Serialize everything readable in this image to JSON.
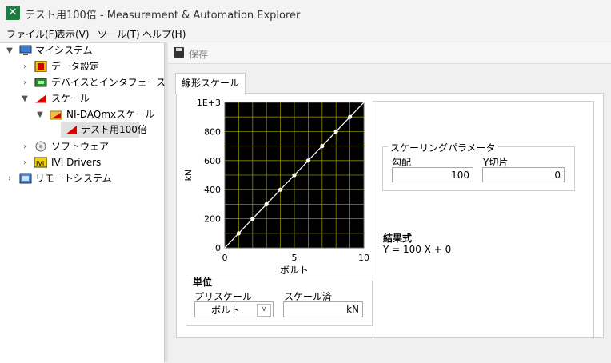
{
  "window": {
    "title": "テスト用100倍 - Measurement & Automation Explorer",
    "icon": "x-logo-icon"
  },
  "menu": [
    {
      "label": "ファイル(F)"
    },
    {
      "label": "表示(V)"
    },
    {
      "label": "ツール(T)"
    },
    {
      "label": "ヘルプ(H)"
    }
  ],
  "tree": {
    "items": [
      {
        "label": "マイシステム",
        "icon": "computer-icon",
        "expanded": true
      },
      {
        "label": "データ設定",
        "icon": "data-config-icon",
        "expanded": false
      },
      {
        "label": "デバイスとインタフェース",
        "icon": "device-icon",
        "expanded": false
      },
      {
        "label": "スケール",
        "icon": "scale-icon",
        "expanded": true
      },
      {
        "label": "NI-DAQmxスケール",
        "icon": "folder-icon",
        "expanded": true
      },
      {
        "label": "テスト用100倍",
        "icon": "scale-icon",
        "selected": true
      },
      {
        "label": "ソフトウェア",
        "icon": "software-icon",
        "expanded": false
      },
      {
        "label": "IVI Drivers",
        "icon": "ivi-icon",
        "expanded": false
      },
      {
        "label": "リモートシステム",
        "icon": "network-icon",
        "expanded": false
      }
    ]
  },
  "toolbar": {
    "save_label": "保存"
  },
  "tab": {
    "label": "線形スケール"
  },
  "chart_data": {
    "type": "line",
    "title": "",
    "xlabel": "ボルト",
    "ylabel": "kN",
    "xlim": [
      0,
      10
    ],
    "ylim": [
      0,
      1000
    ],
    "x_ticks": [
      "0",
      "5",
      "10"
    ],
    "y_ticks": [
      "0",
      "200",
      "400",
      "600",
      "800",
      "1E+3"
    ],
    "grid": true,
    "background": "#000000",
    "grid_color": "#8a8a00",
    "line_color": "#ffffff",
    "series": [
      {
        "x": [
          0,
          1,
          2,
          3,
          4,
          5,
          6,
          7,
          8,
          9,
          10
        ],
        "y": [
          0,
          100,
          200,
          300,
          400,
          500,
          600,
          700,
          800,
          900,
          1000
        ]
      }
    ]
  },
  "units": {
    "title": "単位",
    "prescale_label": "プリスケール",
    "prescale_value": "ボルト",
    "scaled_label": "スケール済",
    "scaled_value": "kN"
  },
  "params": {
    "title": "スケーリングパラメータ",
    "slope_label": "勾配",
    "slope_value": "100",
    "intercept_label": "Y切片",
    "intercept_value": "0"
  },
  "result": {
    "title": "結果式",
    "equation": "Y = 100 X + 0"
  }
}
